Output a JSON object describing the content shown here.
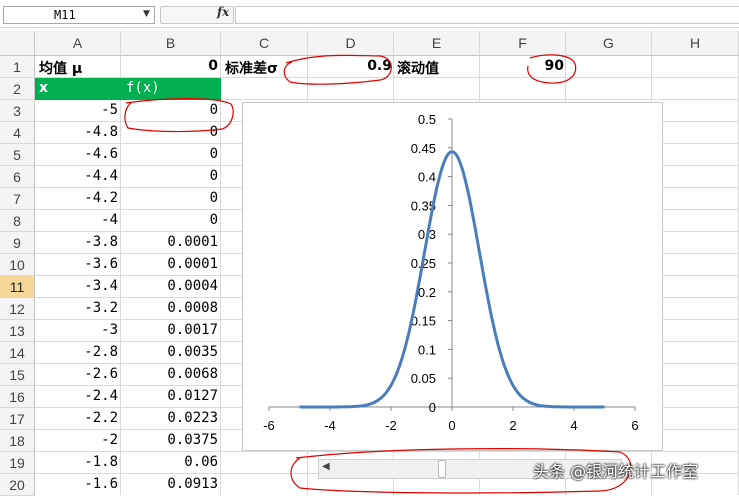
{
  "formula_bar": {
    "name_box": "M11",
    "fx_label": "fx",
    "formula": ""
  },
  "columns": [
    "A",
    "B",
    "C",
    "D",
    "E",
    "F",
    "G",
    "H"
  ],
  "rows": [
    "1",
    "2",
    "3",
    "4",
    "5",
    "6",
    "7",
    "8",
    "9",
    "10",
    "11",
    "12",
    "13",
    "14",
    "15",
    "16",
    "17",
    "18",
    "19",
    "20"
  ],
  "selected_row": "11",
  "params": {
    "mean_label": "均值 μ",
    "mean_value": "0",
    "sd_label": "标准差σ",
    "sd_value": "0.9",
    "scroll_label": "滚动值",
    "scroll_value": "90"
  },
  "table_header": {
    "x": "x",
    "fx": "f(x)"
  },
  "table_rows": [
    {
      "x": "-5",
      "fx": "0"
    },
    {
      "x": "-4.8",
      "fx": "0"
    },
    {
      "x": "-4.6",
      "fx": "0"
    },
    {
      "x": "-4.4",
      "fx": "0"
    },
    {
      "x": "-4.2",
      "fx": "0"
    },
    {
      "x": "-4",
      "fx": "0"
    },
    {
      "x": "-3.8",
      "fx": "0.0001"
    },
    {
      "x": "-3.6",
      "fx": "0.0001"
    },
    {
      "x": "-3.4",
      "fx": "0.0004"
    },
    {
      "x": "-3.2",
      "fx": "0.0008"
    },
    {
      "x": "-3",
      "fx": "0.0017"
    },
    {
      "x": "-2.8",
      "fx": "0.0035"
    },
    {
      "x": "-2.6",
      "fx": "0.0068"
    },
    {
      "x": "-2.4",
      "fx": "0.0127"
    },
    {
      "x": "-2.2",
      "fx": "0.0223"
    },
    {
      "x": "-2",
      "fx": "0.0375"
    },
    {
      "x": "-1.8",
      "fx": "0.06"
    },
    {
      "x": "-1.6",
      "fx": "0.0913"
    }
  ],
  "header_fill_color": "#00b050",
  "curve_color": "#4a7ebb",
  "chart_data": {
    "type": "line",
    "title": "",
    "xlabel": "",
    "ylabel": "",
    "mean": 0,
    "sd": 0.9,
    "x": [
      -5,
      -4.8,
      -4.6,
      -4.4,
      -4.2,
      -4,
      -3.8,
      -3.6,
      -3.4,
      -3.2,
      -3,
      -2.8,
      -2.6,
      -2.4,
      -2.2,
      -2,
      -1.8,
      -1.6,
      -1.4,
      -1.2,
      -1,
      -0.8,
      -0.6,
      -0.4,
      -0.2,
      0,
      0.2,
      0.4,
      0.6,
      0.8,
      1,
      1.2,
      1.4,
      1.6,
      1.8,
      2,
      2.2,
      2.4,
      2.6,
      2.8,
      3,
      3.2,
      3.4,
      3.6,
      3.8,
      4,
      4.2,
      4.4,
      4.6,
      4.8,
      5
    ],
    "series": [
      {
        "values": [
          0,
          0,
          0,
          0,
          0,
          0,
          0.0001,
          0.0001,
          0.0004,
          0.0008,
          0.0017,
          0.0035,
          0.0068,
          0.0127,
          0.0223,
          0.0375,
          0.06,
          0.0913,
          0.1323,
          0.1826,
          0.2399,
          0.2997,
          0.3563,
          0.4032,
          0.4343,
          0.4433,
          0.4343,
          0.4032,
          0.3563,
          0.2997,
          0.2399,
          0.1826,
          0.1323,
          0.0913,
          0.06,
          0.0375,
          0.0223,
          0.0127,
          0.0068,
          0.0035,
          0.0017,
          0.0008,
          0.0004,
          0.0001,
          0.0001,
          0,
          0,
          0,
          0,
          0,
          0
        ]
      }
    ],
    "xlim": [
      -6,
      6
    ],
    "ylim": [
      0,
      0.5
    ],
    "xticks": [
      "-6",
      "-4",
      "-2",
      "0",
      "2",
      "4",
      "6"
    ],
    "yticks": [
      "0",
      "0.05",
      "0.1",
      "0.15",
      "0.2",
      "0.25",
      "0.3",
      "0.35",
      "0.4",
      "0.45",
      "0.5"
    ],
    "grid": false,
    "legend": "none"
  },
  "watermark": "头条 @银河统计工作室"
}
